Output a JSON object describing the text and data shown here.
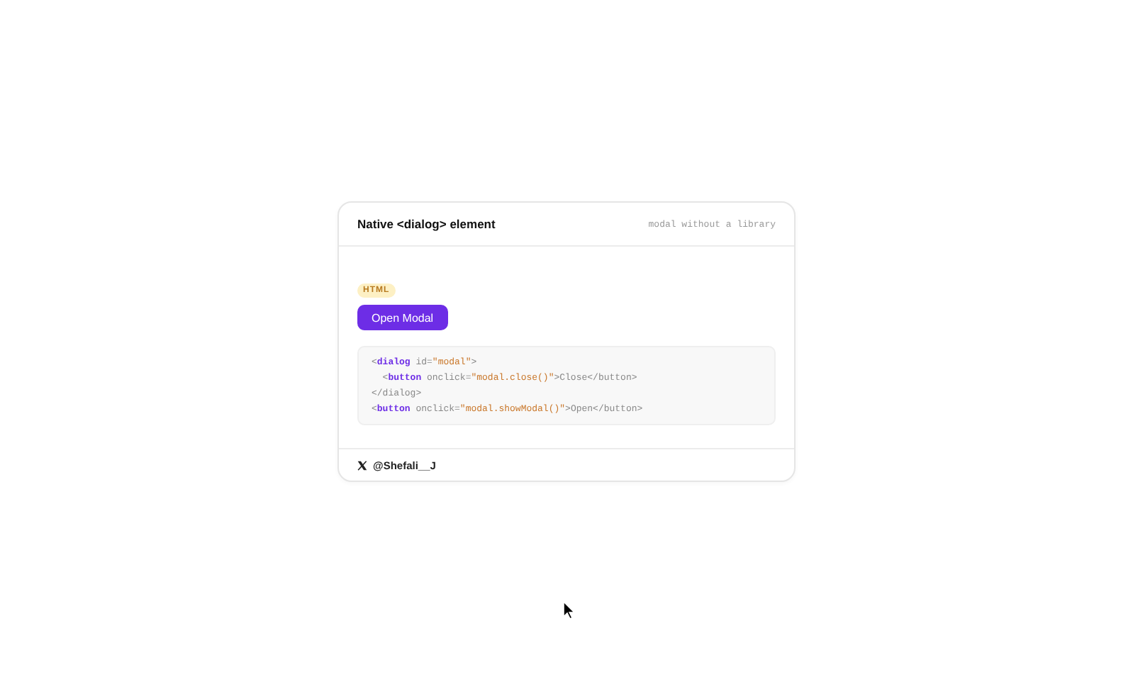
{
  "card": {
    "title": "Native <dialog> element",
    "subtitle": "modal without a library",
    "badge": "HTML",
    "button": "Open Modal",
    "code": [
      [
        {
          "kind": "punct",
          "text": "<"
        },
        {
          "kind": "tag",
          "text": "dialog"
        },
        {
          "kind": "attr",
          "text": " id="
        },
        {
          "kind": "string",
          "text": "\"modal\""
        },
        {
          "kind": "punct",
          "text": ">"
        }
      ],
      [
        {
          "kind": "punct",
          "text": "  <"
        },
        {
          "kind": "tag",
          "text": "button"
        },
        {
          "kind": "attr",
          "text": " onclick="
        },
        {
          "kind": "string",
          "text": "\"modal.close()\""
        },
        {
          "kind": "punct",
          "text": ">Close</button>"
        }
      ],
      [
        {
          "kind": "punct",
          "text": "</dialog>"
        }
      ],
      [
        {
          "kind": "punct",
          "text": "<"
        },
        {
          "kind": "tag",
          "text": "button"
        },
        {
          "kind": "attr",
          "text": " onclick="
        },
        {
          "kind": "string",
          "text": "\"modal.showModal()\""
        },
        {
          "kind": "punct",
          "text": ">Open</button>"
        }
      ]
    ],
    "author": "@Shefali__J"
  }
}
